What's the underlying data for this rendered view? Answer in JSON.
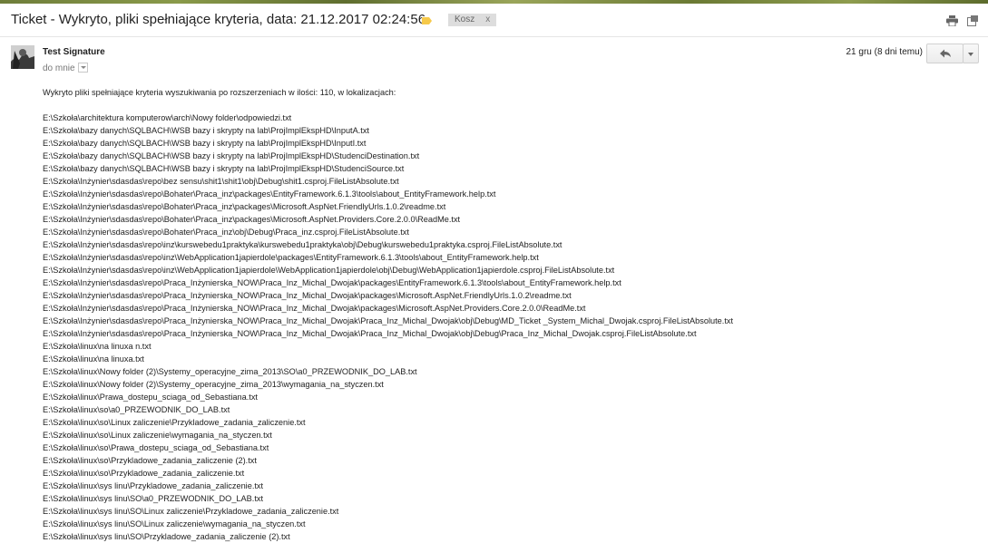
{
  "subject": "Ticket - Wykryto, pliki spełniające kryteria, data: 21.12.2017 02:24:56",
  "label": {
    "name": "Kosz",
    "remove": "x",
    "color": "#f6c94a"
  },
  "icons": [
    "print-icon",
    "popout-icon",
    "reply-icon",
    "chevron-down-icon",
    "label-tag-icon"
  ],
  "sender": "Test Signature",
  "recipient": "do mnie",
  "date": "21 gru (8 dni temu)",
  "intro": "Wykryto pliki spełniające kryteria wyszukiwania po rozszerzeniach w ilości: 110, w lokalizacjach:",
  "paths": [
    "E:\\Szkoła\\architektura komputerow\\arch\\Nowy folder\\odpowiedzi.txt",
    "E:\\Szkoła\\bazy danych\\SQLBACH\\WSB bazy i skrypty na lab\\ProjImplEkspHD\\InputA.txt",
    "E:\\Szkoła\\bazy danych\\SQLBACH\\WSB bazy i skrypty na lab\\ProjImplEkspHD\\InputI.txt",
    "E:\\Szkoła\\bazy danych\\SQLBACH\\WSB bazy i skrypty na lab\\ProjImplEkspHD\\StudenciDestination.txt",
    "E:\\Szkoła\\bazy danych\\SQLBACH\\WSB bazy i skrypty na lab\\ProjImplEkspHD\\StudenciSource.txt",
    "E:\\Szkoła\\Inżynier\\sdasdas\\repo\\bez sensu\\shit1\\shit1\\obj\\Debug\\shit1.csproj.FileListAbsolute.txt",
    "E:\\Szkoła\\Inżynier\\sdasdas\\repo\\Bohater\\Praca_inz\\packages\\EntityFramework.6.1.3\\tools\\about_EntityFramework.help.txt",
    "E:\\Szkoła\\Inżynier\\sdasdas\\repo\\Bohater\\Praca_inz\\packages\\Microsoft.AspNet.FriendlyUrls.1.0.2\\readme.txt",
    "E:\\Szkoła\\Inżynier\\sdasdas\\repo\\Bohater\\Praca_inz\\packages\\Microsoft.AspNet.Providers.Core.2.0.0\\ReadMe.txt",
    "E:\\Szkoła\\Inżynier\\sdasdas\\repo\\Bohater\\Praca_inz\\obj\\Debug\\Praca_inz.csproj.FileListAbsolute.txt",
    "E:\\Szkoła\\Inżynier\\sdasdas\\repo\\inz\\kurswebedu1praktyka\\kurswebedu1praktyka\\obj\\Debug\\kurswebedu1praktyka.csproj.FileListAbsolute.txt",
    "E:\\Szkoła\\Inżynier\\sdasdas\\repo\\inz\\WebApplication1japierdole\\packages\\EntityFramework.6.1.3\\tools\\about_EntityFramework.help.txt",
    "E:\\Szkoła\\Inżynier\\sdasdas\\repo\\inz\\WebApplication1japierdole\\WebApplication1japierdole\\obj\\Debug\\WebApplication1japierdole.csproj.FileListAbsolute.txt",
    "E:\\Szkoła\\Inżynier\\sdasdas\\repo\\Praca_Inżynierska_NOW\\Praca_Inz_Michal_Dwojak\\packages\\EntityFramework.6.1.3\\tools\\about_EntityFramework.help.txt",
    "E:\\Szkoła\\Inżynier\\sdasdas\\repo\\Praca_Inżynierska_NOW\\Praca_Inz_Michal_Dwojak\\packages\\Microsoft.AspNet.FriendlyUrls.1.0.2\\readme.txt",
    "E:\\Szkoła\\Inżynier\\sdasdas\\repo\\Praca_Inżynierska_NOW\\Praca_Inz_Michal_Dwojak\\packages\\Microsoft.AspNet.Providers.Core.2.0.0\\ReadMe.txt",
    "E:\\Szkoła\\Inżynier\\sdasdas\\repo\\Praca_Inżynierska_NOW\\Praca_Inz_Michal_Dwojak\\Praca_Inz_Michal_Dwojak\\obj\\Debug\\MD_Ticket _System_Michal_Dwojak.csproj.FileListAbsolute.txt",
    "E:\\Szkoła\\Inżynier\\sdasdas\\repo\\Praca_Inżynierska_NOW\\Praca_Inz_Michal_Dwojak\\Praca_Inz_Michal_Dwojak\\obj\\Debug\\Praca_Inz_Michal_Dwojak.csproj.FileListAbsolute.txt",
    "E:\\Szkoła\\linux\\na linuxa n.txt",
    "E:\\Szkoła\\linux\\na linuxa.txt",
    "E:\\Szkoła\\linux\\Nowy folder (2)\\Systemy_operacyjne_zima_2013\\SO\\a0_PRZEWODNIK_DO_LAB.txt",
    "E:\\Szkoła\\linux\\Nowy folder (2)\\Systemy_operacyjne_zima_2013\\wymagania_na_styczen.txt",
    "E:\\Szkoła\\linux\\Prawa_dostepu_sciaga_od_Sebastiana.txt",
    "E:\\Szkoła\\linux\\so\\a0_PRZEWODNIK_DO_LAB.txt",
    "E:\\Szkoła\\linux\\so\\Linux zaliczenie\\Przykladowe_zadania_zaliczenie.txt",
    "E:\\Szkoła\\linux\\so\\Linux zaliczenie\\wymagania_na_styczen.txt",
    "E:\\Szkoła\\linux\\so\\Prawa_dostepu_sciaga_od_Sebastiana.txt",
    "E:\\Szkoła\\linux\\so\\Przykladowe_zadania_zaliczenie (2).txt",
    "E:\\Szkoła\\linux\\so\\Przykladowe_zadania_zaliczenie.txt",
    "E:\\Szkoła\\linux\\sys linu\\Przykladowe_zadania_zaliczenie.txt",
    "E:\\Szkoła\\linux\\sys linu\\SO\\a0_PRZEWODNIK_DO_LAB.txt",
    "E:\\Szkoła\\linux\\sys linu\\SO\\Linux zaliczenie\\Przykladowe_zadania_zaliczenie.txt",
    "E:\\Szkoła\\linux\\sys linu\\SO\\Linux zaliczenie\\wymagania_na_styczen.txt",
    "E:\\Szkoła\\linux\\sys linu\\SO\\Przykladowe_zadania_zaliczenie (2).txt"
  ]
}
